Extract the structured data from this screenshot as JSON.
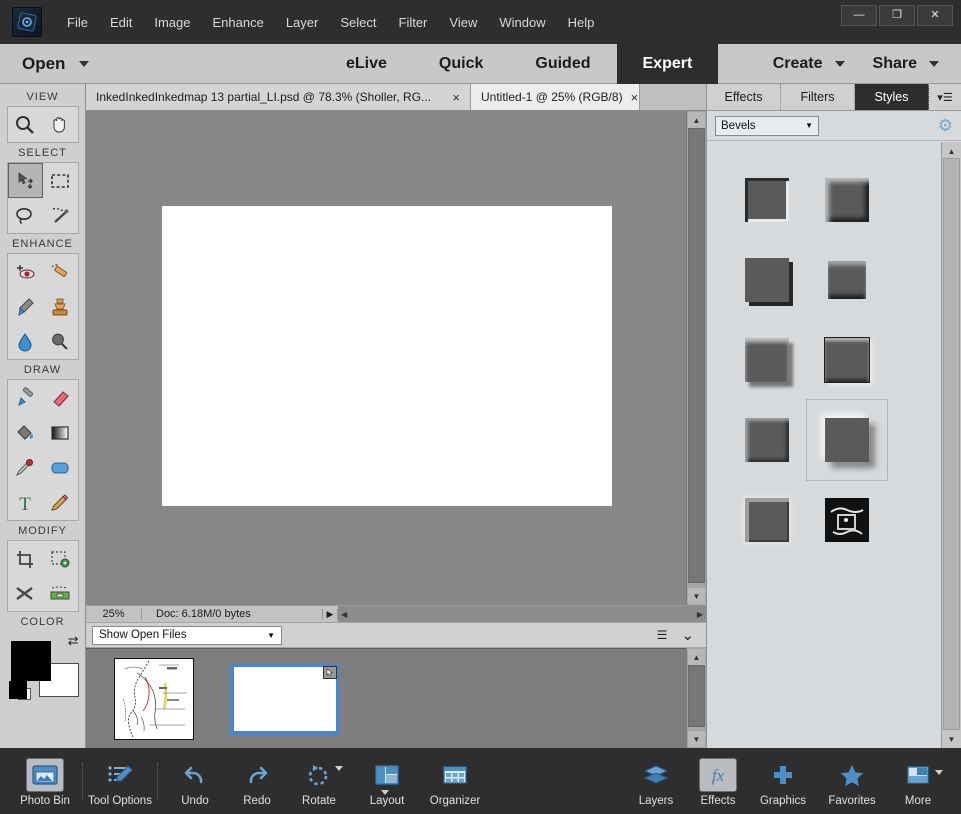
{
  "window": {
    "minimize_label": "—",
    "maximize_label": "❐",
    "close_label": "✕"
  },
  "menubar": {
    "logo_name": "photoshop-elements-logo",
    "items": [
      "File",
      "Edit",
      "Image",
      "Enhance",
      "Layer",
      "Select",
      "Filter",
      "View",
      "Window",
      "Help"
    ]
  },
  "modebar": {
    "open_label": "Open",
    "tabs": [
      {
        "label": "eLive",
        "active": false
      },
      {
        "label": "Quick",
        "active": false
      },
      {
        "label": "Guided",
        "active": false
      },
      {
        "label": "Expert",
        "active": true
      }
    ],
    "create_label": "Create",
    "share_label": "Share"
  },
  "toolbar": {
    "sections": [
      {
        "label": "VIEW",
        "tools": [
          {
            "name": "zoom-tool",
            "active": false
          },
          {
            "name": "hand-tool",
            "active": false
          }
        ]
      },
      {
        "label": "SELECT",
        "tools": [
          {
            "name": "move-tool",
            "active": true
          },
          {
            "name": "rectangular-marquee-tool",
            "active": false
          },
          {
            "name": "lasso-tool",
            "active": false
          },
          {
            "name": "quick-selection-tool",
            "active": false
          }
        ]
      },
      {
        "label": "ENHANCE",
        "tools": [
          {
            "name": "red-eye-removal-tool",
            "active": false
          },
          {
            "name": "spot-healing-brush-tool",
            "active": false
          },
          {
            "name": "smart-brush-tool",
            "active": false
          },
          {
            "name": "clone-stamp-tool",
            "active": false
          },
          {
            "name": "blur-tool",
            "active": false
          },
          {
            "name": "sponge-tool",
            "active": false
          }
        ]
      },
      {
        "label": "DRAW",
        "tools": [
          {
            "name": "brush-tool",
            "active": false
          },
          {
            "name": "eraser-tool",
            "active": false
          },
          {
            "name": "paint-bucket-tool",
            "active": false
          },
          {
            "name": "gradient-tool",
            "active": false
          },
          {
            "name": "eyedropper-tool",
            "active": false
          },
          {
            "name": "shape-tool",
            "active": false
          },
          {
            "name": "type-tool",
            "active": false
          },
          {
            "name": "pencil-tool",
            "active": false
          }
        ]
      },
      {
        "label": "MODIFY",
        "tools": [
          {
            "name": "crop-tool",
            "active": false
          },
          {
            "name": "recompose-tool",
            "active": false
          },
          {
            "name": "content-aware-move-tool",
            "active": false
          },
          {
            "name": "straighten-tool",
            "active": false
          }
        ]
      },
      {
        "label": "COLOR",
        "tools": []
      }
    ],
    "foreground_color": "#000000",
    "background_color": "#ffffff"
  },
  "doctabs": [
    {
      "title": "InkedInkedInkedmap 13 partial_LI.psd @ 78.3% (Sholler, RG...",
      "active": false,
      "close": "×"
    },
    {
      "title": "Untitled-1 @ 25% (RGB/8)",
      "active": true,
      "close": "×"
    }
  ],
  "statusbar": {
    "zoom": "25%",
    "doc_info": "Doc: 6.18M/0 bytes",
    "expand_arrow": "▶",
    "scroll_left": "◀",
    "scroll_right": "▶"
  },
  "openfilesbar": {
    "select_value": "Show Open Files",
    "caret": "▼",
    "menu_icon": "panel-menu-icon",
    "collapse_icon": "⌄"
  },
  "photobin": {
    "items": [
      {
        "name": "bin-thumbnail-map",
        "badge": false
      },
      {
        "name": "bin-thumbnail-untitled",
        "badge": true,
        "selected": true
      }
    ]
  },
  "rightpanel": {
    "tabs": [
      {
        "label": "Effects",
        "active": false
      },
      {
        "label": "Filters",
        "active": false
      },
      {
        "label": "Styles",
        "active": true
      }
    ],
    "menu_icon": "panel-menu-icon",
    "category": "Bevels",
    "category_caret": "▼",
    "settings_icon": "gear-icon",
    "styles": [
      {
        "name": "style-simple-inner",
        "selected": false
      },
      {
        "name": "style-simple-sharp-inner",
        "selected": false
      },
      {
        "name": "style-simple-sharp-outer",
        "selected": false
      },
      {
        "name": "style-scalloped-edge",
        "selected": false
      },
      {
        "name": "style-simple-emboss",
        "selected": false
      },
      {
        "name": "style-simple-pillow-emboss",
        "selected": false
      },
      {
        "name": "style-inset-bevel",
        "selected": false
      },
      {
        "name": "style-simple-outer",
        "selected": true
      },
      {
        "name": "style-simple-sharp-pillow-emboss",
        "selected": false
      },
      {
        "name": "style-wireframe",
        "selected": false
      }
    ]
  },
  "taskbar": {
    "left_items": [
      {
        "label": "Photo Bin",
        "icon": "photo-bin-icon",
        "active": true
      },
      {
        "label": "Tool Options",
        "icon": "tool-options-icon",
        "active": false
      },
      {
        "label": "Undo",
        "icon": "undo-arrow-icon",
        "active": false
      },
      {
        "label": "Redo",
        "icon": "redo-arrow-icon",
        "active": false
      },
      {
        "label": "Rotate",
        "icon": "rotate-icon",
        "active": false,
        "caret": true
      },
      {
        "label": "Layout",
        "icon": "layout-icon",
        "active": false,
        "caret": true
      },
      {
        "label": "Organizer",
        "icon": "organizer-icon",
        "active": false
      }
    ],
    "right_items": [
      {
        "label": "Layers",
        "icon": "layers-icon",
        "active": false
      },
      {
        "label": "Effects",
        "icon": "fx-icon",
        "active": true
      },
      {
        "label": "Graphics",
        "icon": "plus-icon",
        "active": false
      },
      {
        "label": "Favorites",
        "icon": "star-icon",
        "active": false
      },
      {
        "label": "More",
        "icon": "more-panel-icon",
        "active": false,
        "caret": true
      }
    ]
  }
}
